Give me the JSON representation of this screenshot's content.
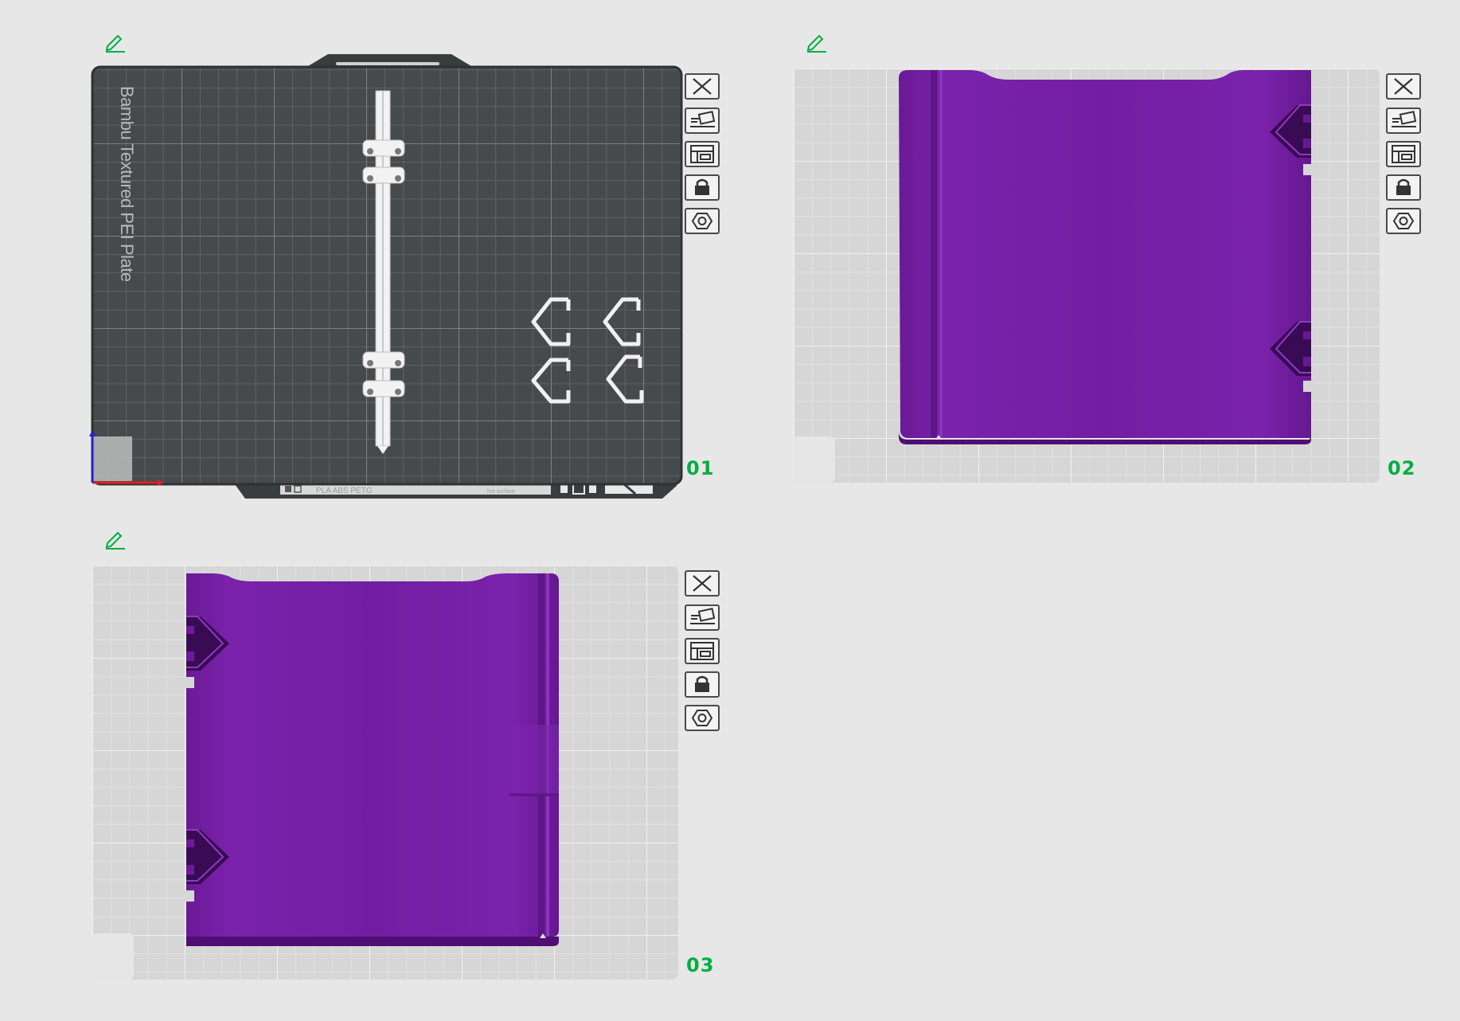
{
  "colors": {
    "accent": "#00ae42",
    "background": "#e7e7e7",
    "dark_plate": "#474a4b",
    "light_plate": "#d6d6d6",
    "model_purple": "#721ea2",
    "toolbar_border": "#4a4a4a"
  },
  "plates": [
    {
      "number": "01",
      "bed_label": "Bambu Textured PEI Plate",
      "strip_text": "PLA ABS PETG",
      "strip_text_2": "hot surface",
      "selected": true
    },
    {
      "number": "02",
      "selected": false
    },
    {
      "number": "03",
      "selected": false
    }
  ],
  "toolbar_icons": [
    "close-icon",
    "auto-arrange-icon",
    "layout-icon",
    "lock-icon",
    "settings-icon"
  ],
  "edit_icon": "pencil-icon"
}
